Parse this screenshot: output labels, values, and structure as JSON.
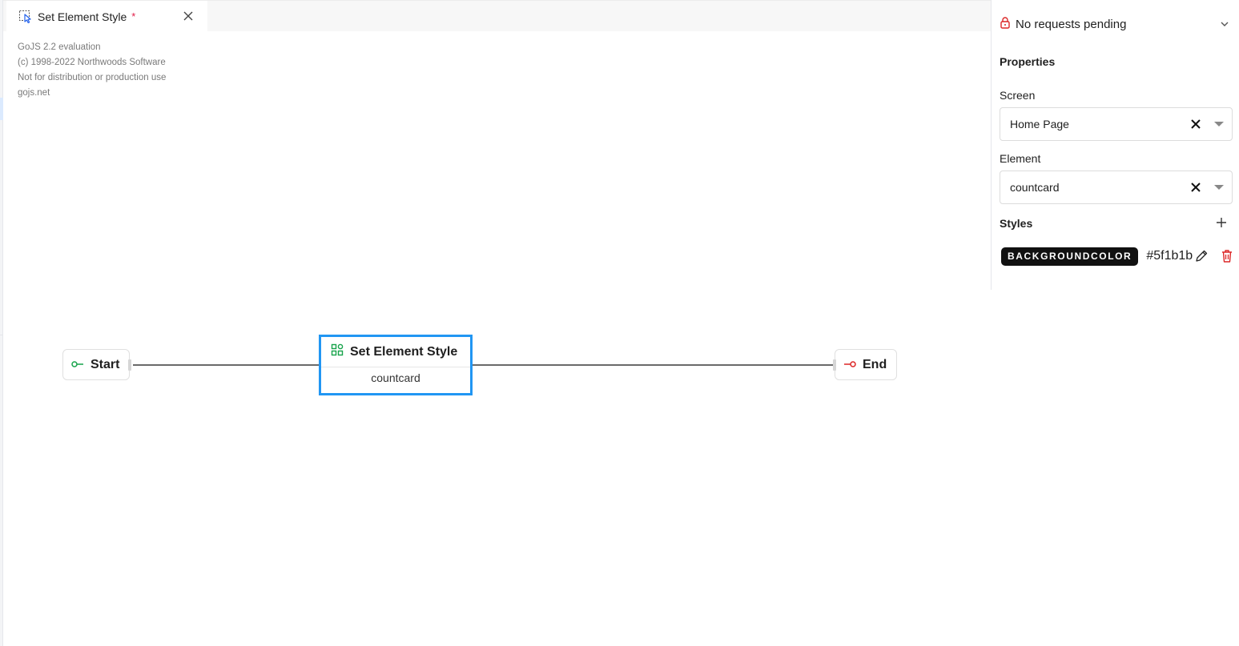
{
  "tab": {
    "title": "Set Element Style",
    "modified_marker": "*"
  },
  "watermark": {
    "line1": "GoJS 2.2 evaluation",
    "line2": "(c) 1998-2022 Northwoods Software",
    "line3": "Not for distribution or production use",
    "line4": "gojs.net"
  },
  "flow": {
    "start_label": "Start",
    "end_label": "End",
    "action_title": "Set Element Style",
    "action_subtitle": "countcard"
  },
  "panel": {
    "pending_text": "No requests pending",
    "properties_title": "Properties",
    "screen_label": "Screen",
    "screen_value": "Home Page",
    "element_label": "Element",
    "element_value": "countcard",
    "styles_title": "Styles",
    "styles": [
      {
        "property": "BACKGROUNDCOLOR",
        "value": "#5f1b1b"
      }
    ]
  },
  "colors": {
    "selection": "#2196f3",
    "start_icon": "#16a34a",
    "end_icon": "#dc2626",
    "action_icon": "#16a34a",
    "lock_icon": "#dc2626",
    "delete_icon": "#dc2626",
    "chip_bg": "#111111"
  },
  "icons": {
    "tab": "pointer-select-icon",
    "close": "close-icon",
    "lock": "lock-icon",
    "chevron": "chevron-down-icon",
    "start": "start-port-icon",
    "end": "end-port-icon",
    "action": "components-icon",
    "clear": "clear-x-icon",
    "add": "plus-icon",
    "edit": "pencil-icon",
    "delete": "trash-icon"
  }
}
